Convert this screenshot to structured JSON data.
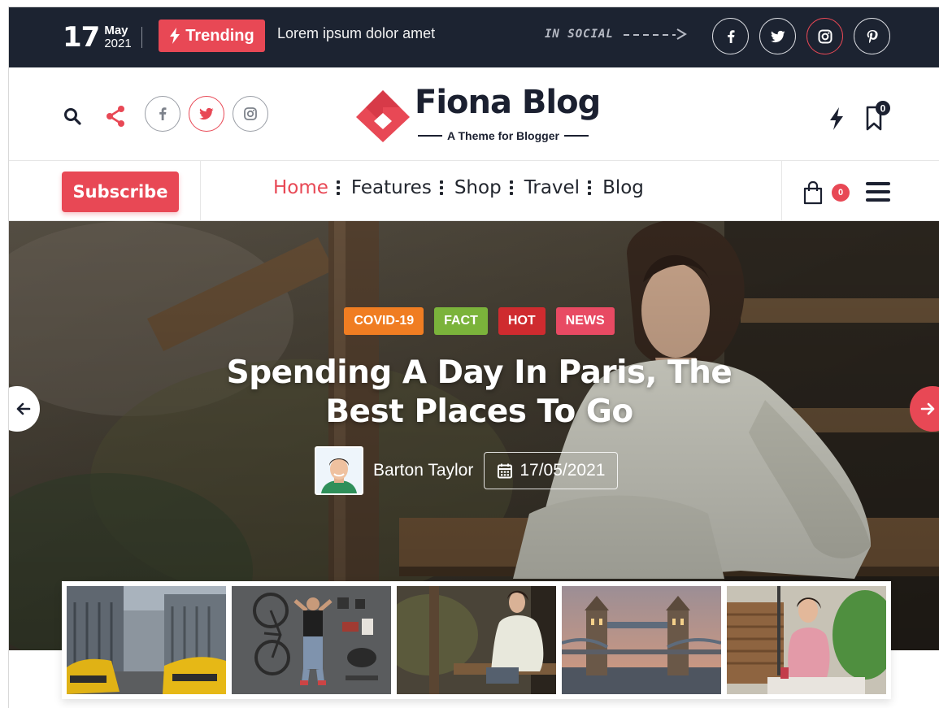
{
  "topbar": {
    "day": "17",
    "month": "May",
    "year": "2021",
    "trending_label": "Trending",
    "ticker_text": "Lorem ipsum dolor amet",
    "social_label": "IN SOCIAL",
    "socials": [
      "facebook-icon",
      "twitter-icon",
      "instagram-icon",
      "pinterest-icon"
    ],
    "active_social": "instagram-icon"
  },
  "header": {
    "brand_name": "Fiona Blog",
    "tagline": "A Theme for Blogger",
    "socials": [
      "facebook-icon",
      "twitter-icon",
      "instagram-icon"
    ],
    "active_social": "twitter-icon",
    "bookmark_count": "0"
  },
  "nav": {
    "subscribe_label": "Subscribe",
    "items": [
      {
        "label": "Home",
        "active": true
      },
      {
        "label": "Features",
        "active": false
      },
      {
        "label": "Shop",
        "active": false
      },
      {
        "label": "Travel",
        "active": false
      },
      {
        "label": "Blog",
        "active": false
      }
    ],
    "cart_count": "0"
  },
  "hero": {
    "tags": [
      {
        "label": "COVID-19",
        "color": "#f07d22"
      },
      {
        "label": "FACT",
        "color": "#7bb33b"
      },
      {
        "label": "HOT",
        "color": "#cf2b2f"
      },
      {
        "label": "NEWS",
        "color": "#e84a63"
      }
    ],
    "title": "Spending A Day In Paris, The Best Places To Go",
    "author": "Barton Taylor",
    "date": "17/05/2021"
  },
  "colors": {
    "accent": "#e84855",
    "dark": "#1c2331"
  }
}
